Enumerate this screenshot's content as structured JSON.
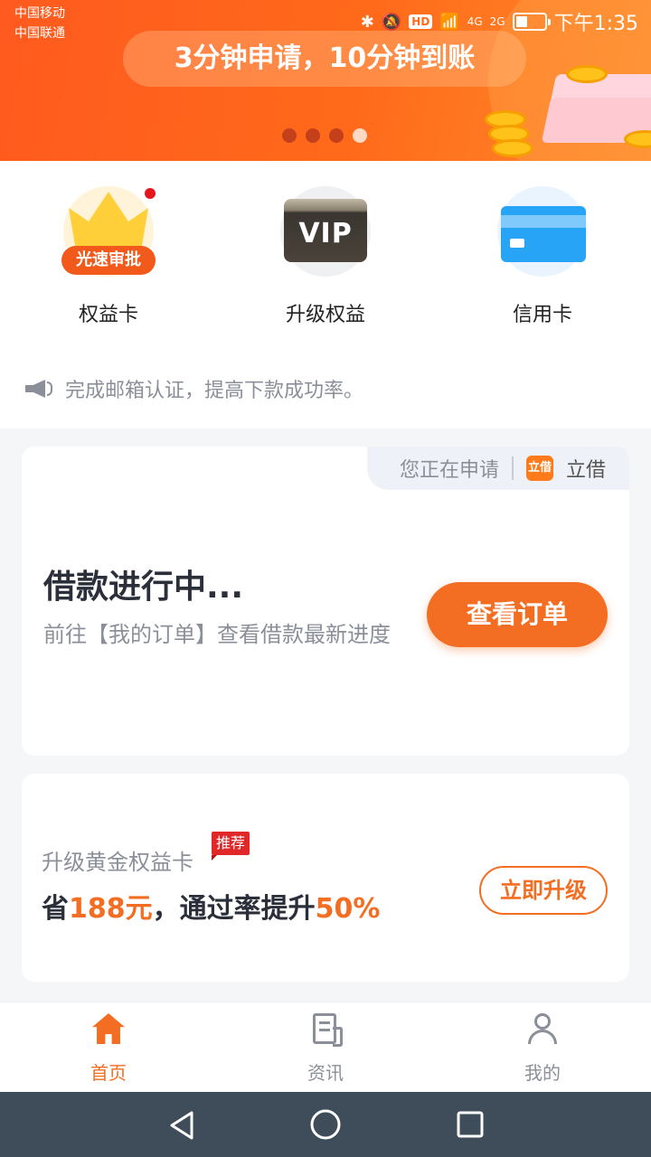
{
  "status_bar": {
    "carrier_1": "中国移动",
    "carrier_2": "中国联通",
    "hd_badge": "HD",
    "net_1": "4G",
    "net_2": "2G",
    "time": "下午1:35"
  },
  "banner": {
    "slogan": "3分钟申请，10分钟到账",
    "page_count": 4,
    "active_index": 3
  },
  "quick_menu": {
    "items": [
      {
        "label": "权益卡",
        "icon": "crown-icon",
        "badge": "光速审批",
        "has_red_dot": true
      },
      {
        "label": "升级权益",
        "icon": "vip-card-icon",
        "badge": "VIP"
      },
      {
        "label": "信用卡",
        "icon": "credit-card-icon"
      }
    ]
  },
  "notice": {
    "icon": "speaker-icon",
    "text": "完成邮箱认证，提高下款成功率。"
  },
  "loan_card": {
    "applying_label": "您正在申请",
    "app_logo_text": "立借",
    "app_name": "立借",
    "title": "借款进行中...",
    "description": "前往【我的订单】查看借款最新进度",
    "button_label": "查看订单"
  },
  "upgrade_card": {
    "title": "升级黄金权益卡",
    "badge": "推荐",
    "line_prefix": "省",
    "line_amount": "188元",
    "line_middle": "，通过率提升",
    "line_rate": "50%",
    "button_label": "立即升级"
  },
  "tab_bar": {
    "tabs": [
      {
        "label": "首页",
        "icon": "home-icon",
        "active": true
      },
      {
        "label": "资讯",
        "icon": "news-icon",
        "active": false
      },
      {
        "label": "我的",
        "icon": "user-icon",
        "active": false
      }
    ]
  },
  "colors": {
    "accent": "#f36e22",
    "banner": "#ff5a1f",
    "text_primary": "#2b2f3a",
    "text_secondary": "#8a8f99",
    "nav_bar": "#3f4c5a"
  }
}
